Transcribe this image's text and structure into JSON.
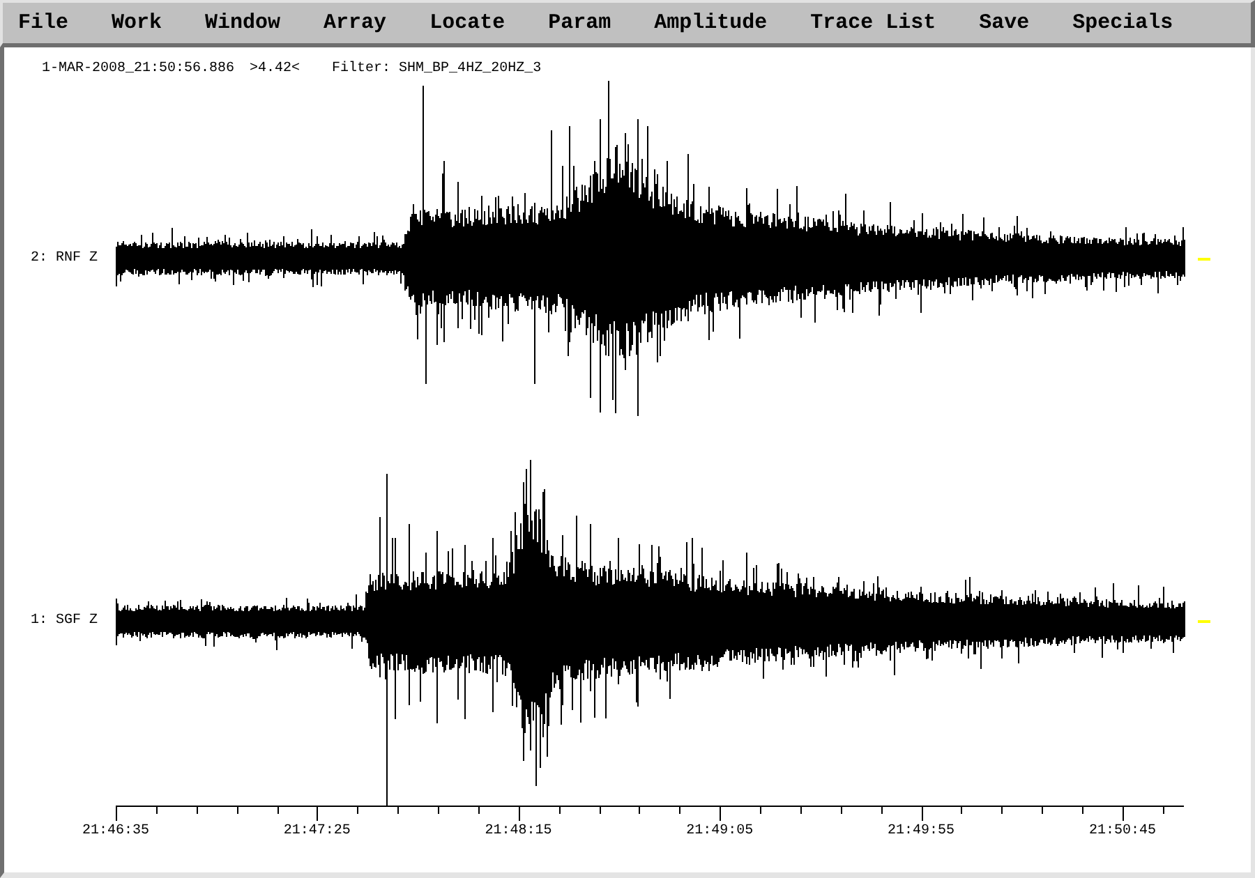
{
  "menu_bar": {
    "items": [
      "File",
      "Work",
      "Window",
      "Array",
      "Locate",
      "Param",
      "Amplitude",
      "Trace List",
      "Save",
      "Specials"
    ]
  },
  "header": {
    "timestamp": "1-MAR-2008_21:50:56.886",
    "amplitude": ">4.42<",
    "filter": "Filter: SHM_BP_4HZ_20HZ_3"
  },
  "traces": [
    {
      "label": "2: RNF Z"
    },
    {
      "label": "1: SGF Z"
    }
  ],
  "time_axis": {
    "labels": [
      "21:46:35",
      "21:47:25",
      "21:48:15",
      "21:49:05",
      "21:49:55",
      "21:50:45"
    ]
  }
}
